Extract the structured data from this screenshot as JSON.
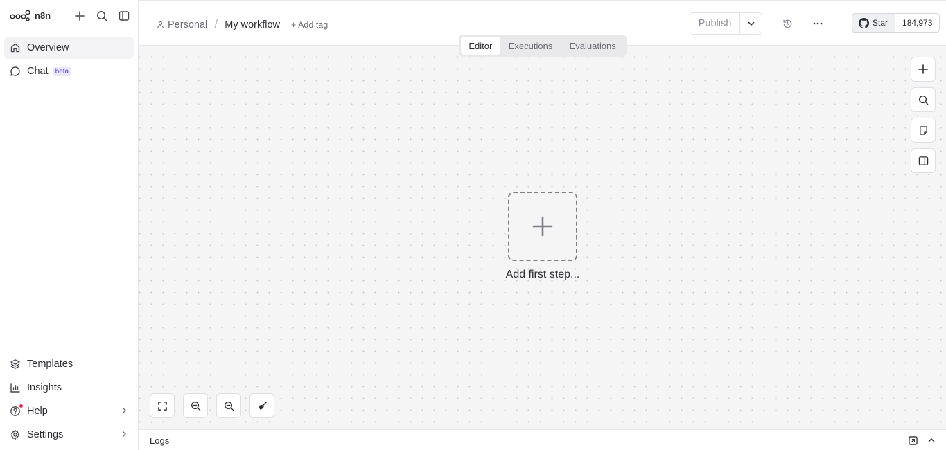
{
  "sidebar": {
    "brand": "n8n",
    "nav_top": [
      {
        "label": "Overview",
        "icon": "home-icon",
        "active": true
      },
      {
        "label": "Chat",
        "icon": "chat-icon",
        "badge": "beta"
      }
    ],
    "nav_bottom": [
      {
        "label": "Templates",
        "icon": "templates-icon"
      },
      {
        "label": "Insights",
        "icon": "insights-icon"
      },
      {
        "label": "Help",
        "icon": "help-icon"
      },
      {
        "label": "Settings",
        "icon": "gear-icon"
      }
    ]
  },
  "header": {
    "breadcrumb_project": "Personal",
    "breadcrumb_separator": "/",
    "workflow_name": "My workflow",
    "add_tag": "+ Add tag",
    "publish_label": "Publish",
    "github": {
      "star_label": "Star",
      "star_count": "184,973"
    }
  },
  "tabs": [
    {
      "label": "Editor",
      "active": true
    },
    {
      "label": "Executions"
    },
    {
      "label": "Evaluations"
    }
  ],
  "canvas": {
    "add_first_step": "Add first step..."
  },
  "logs": {
    "label": "Logs"
  },
  "colors": {
    "accent_badge": "#5b3fd4",
    "notification_dot": "#e5274d",
    "canvas_bg": "#f5f5f6"
  }
}
